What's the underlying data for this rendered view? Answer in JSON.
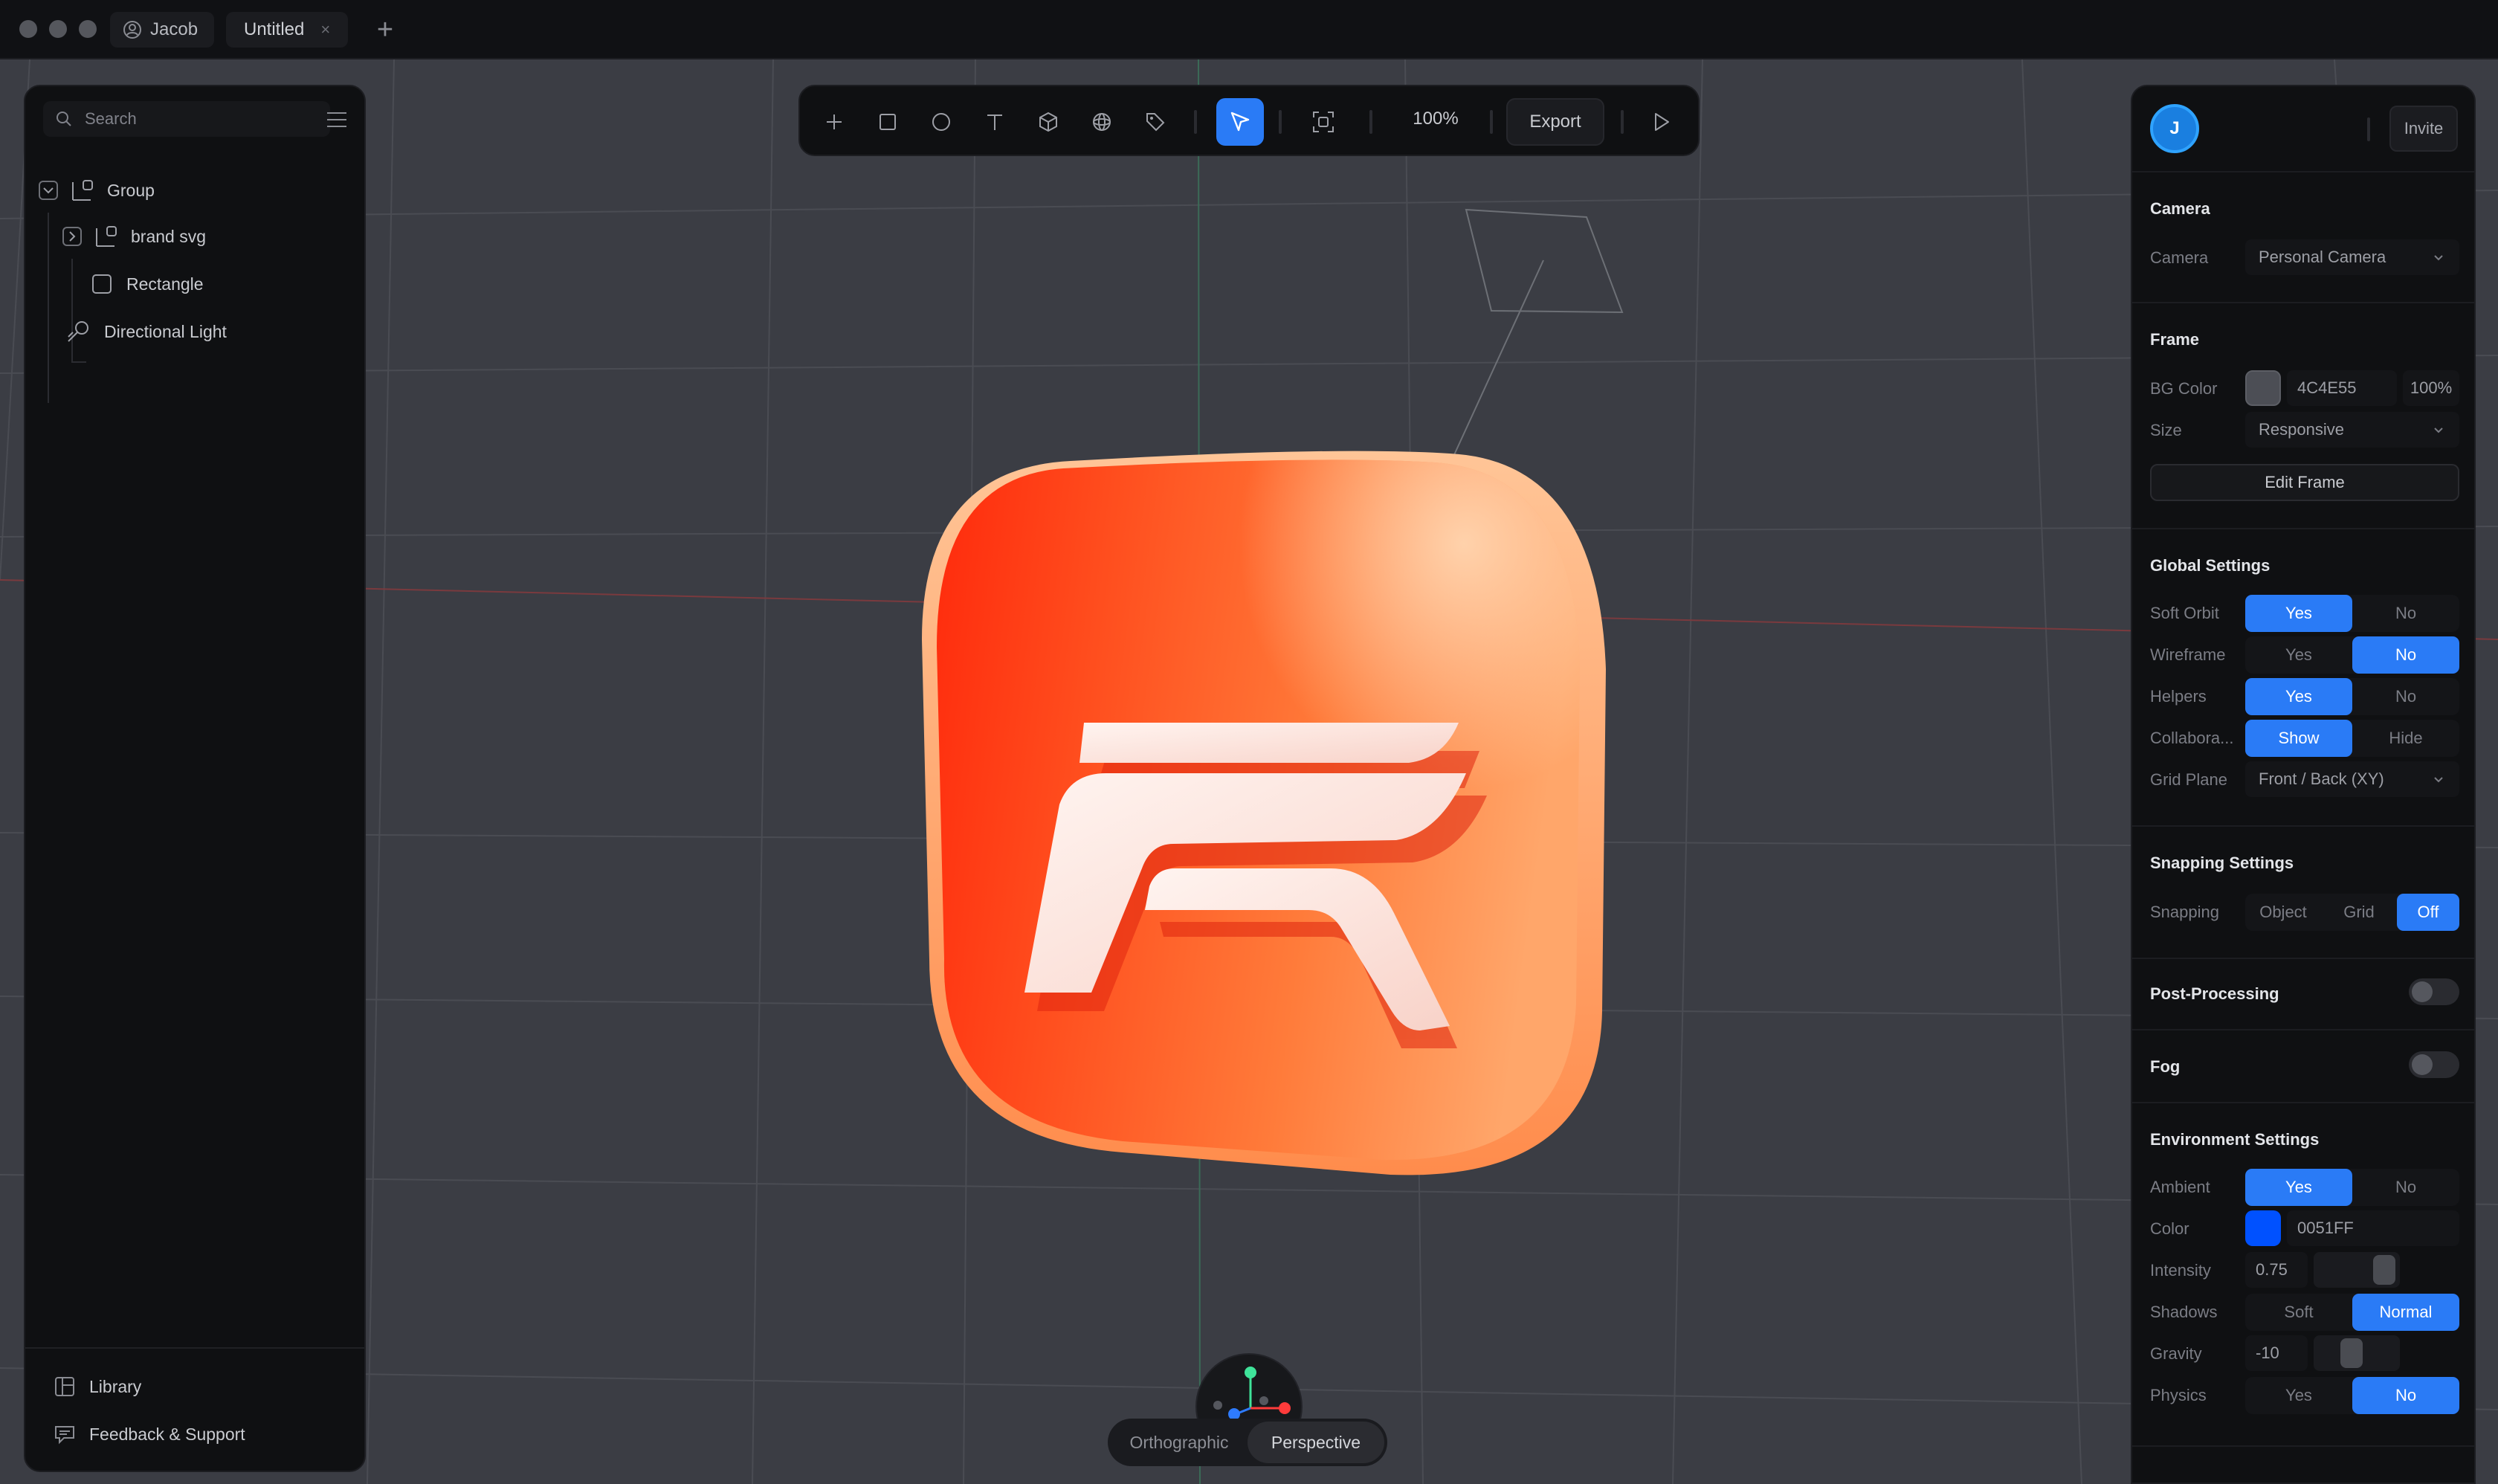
{
  "titlebar": {
    "user_name": "Jacob",
    "tab_title": "Untitled",
    "tab_close": "×",
    "new_tab": "+"
  },
  "left_panel": {
    "search_placeholder": "Search",
    "layers": [
      {
        "label": "Group",
        "icon": "group-icon"
      },
      {
        "label": "brand svg",
        "icon": "group-icon"
      },
      {
        "label": "Rectangle",
        "icon": "rectangle-icon"
      },
      {
        "label": "Directional Light",
        "icon": "light-icon"
      }
    ],
    "footer": [
      {
        "label": "Library",
        "icon": "library-icon"
      },
      {
        "label": "Feedback & Support",
        "icon": "chat-icon"
      }
    ]
  },
  "toolbar": {
    "tools": [
      "add-icon",
      "rectangle-icon",
      "ellipse-icon",
      "text-icon",
      "cube-icon",
      "sphere-icon",
      "tag-icon",
      "select-cursor-icon",
      "frame-focus-icon",
      "play-icon"
    ],
    "active_tool": "select-cursor-icon",
    "zoom": "100%",
    "export_label": "Export"
  },
  "view_toggle": {
    "options": [
      "Orthographic",
      "Perspective"
    ],
    "selected": "Perspective"
  },
  "right_panel": {
    "avatar_initial": "J",
    "invite_label": "Invite",
    "camera": {
      "title": "Camera",
      "label": "Camera",
      "value": "Personal Camera"
    },
    "frame": {
      "title": "Frame",
      "bg_label": "BG Color",
      "bg_hex": "4C4E55",
      "bg_opacity": "100%",
      "size_label": "Size",
      "size_value": "Responsive",
      "edit_label": "Edit Frame"
    },
    "global": {
      "title": "Global Settings",
      "rows": [
        {
          "label": "Soft Orbit",
          "a": "Yes",
          "b": "No",
          "selected": "a"
        },
        {
          "label": "Wireframe",
          "a": "Yes",
          "b": "No",
          "selected": "b"
        },
        {
          "label": "Helpers",
          "a": "Yes",
          "b": "No",
          "selected": "a"
        },
        {
          "label": "Collabora...",
          "a": "Show",
          "b": "Hide",
          "selected": "a"
        }
      ],
      "grid_label": "Grid Plane",
      "grid_value": "Front / Back (XY)"
    },
    "snapping": {
      "title": "Snapping Settings",
      "label": "Snapping",
      "options": [
        "Object",
        "Grid",
        "Off"
      ],
      "selected": "Off"
    },
    "post_processing": {
      "title": "Post-Processing",
      "on": false
    },
    "fog": {
      "title": "Fog",
      "on": false
    },
    "environment": {
      "title": "Environment Settings",
      "ambient_label": "Ambient",
      "ambient_a": "Yes",
      "ambient_b": "No",
      "color_label": "Color",
      "color_hex": "0051FF",
      "intensity_label": "Intensity",
      "intensity_value": "0.75",
      "shadows_label": "Shadows",
      "shadows_a": "Soft",
      "shadows_b": "Normal",
      "gravity_label": "Gravity",
      "gravity_value": "-10",
      "physics_label": "Physics",
      "physics_a": "Yes",
      "physics_b": "No"
    }
  },
  "colors": {
    "accent": "#2A7BF6",
    "panel": "#0F1012",
    "canvas": "#3B3D44",
    "ambient_swatch": "#0051FF",
    "bg_swatch": "#4C4E55",
    "object_orange": "#FF6A2A"
  }
}
